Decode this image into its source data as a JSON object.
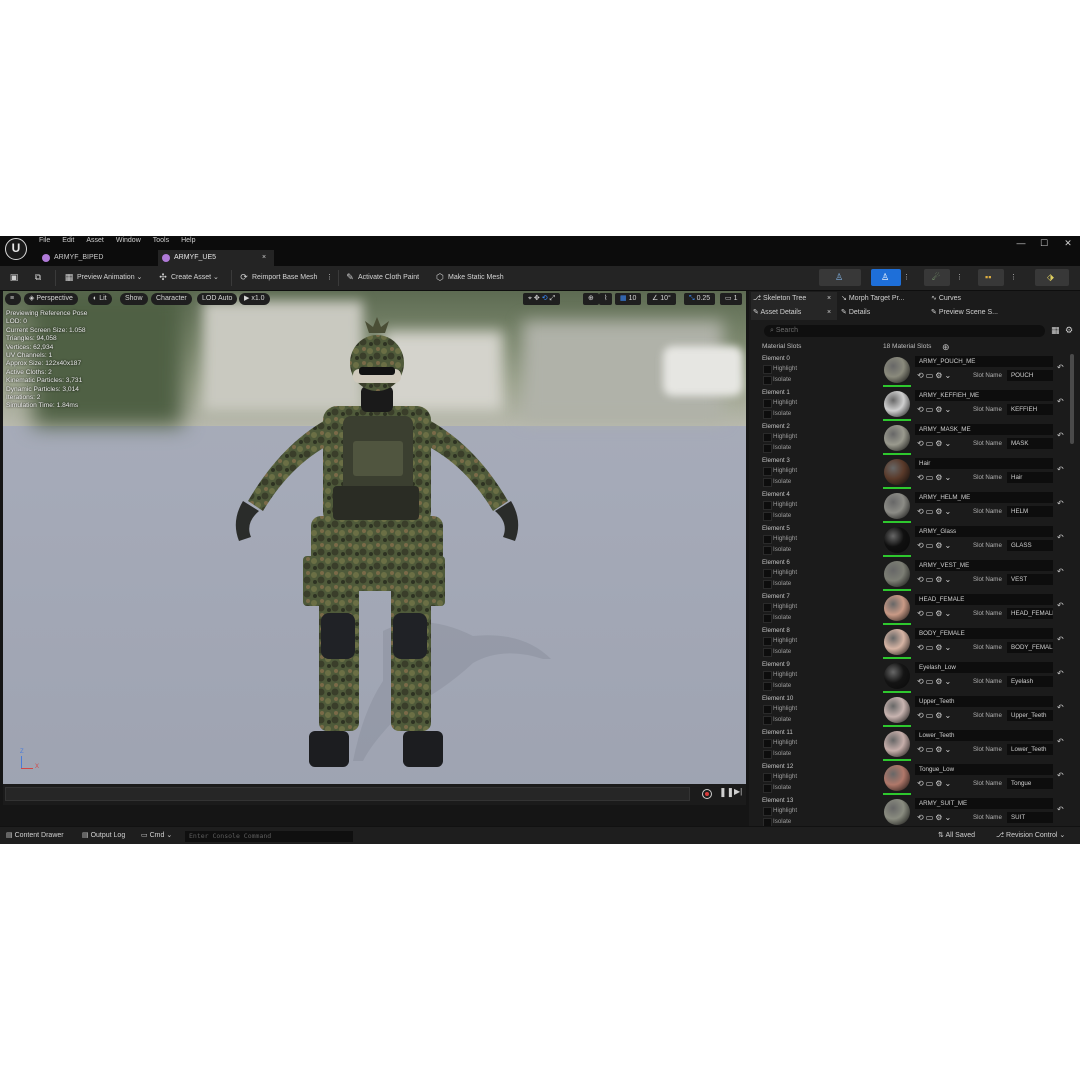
{
  "menu": [
    "File",
    "Edit",
    "Asset",
    "Window",
    "Tools",
    "Help"
  ],
  "tabs": [
    {
      "label": "ARMYF_BIPED"
    },
    {
      "label": "ARMYF_UE5",
      "close": "×"
    }
  ],
  "window_controls": {
    "minimize": "—",
    "maximize": "☐",
    "close": "✕"
  },
  "toolbar": {
    "preview_animation": "Preview Animation",
    "create_asset": "Create Asset",
    "reimport": "Reimport Base Mesh",
    "cloth_paint": "Activate Cloth Paint",
    "static_mesh": "Make Static Mesh"
  },
  "viewport": {
    "perspective": "Perspective",
    "lit": "Lit",
    "show": "Show",
    "character": "Character",
    "lod": "LOD Auto",
    "speed": "x1.0",
    "grid": "10",
    "angle": "10°",
    "scale": "0.25",
    "cam": "1",
    "stats": [
      "Previewing Reference Pose",
      "LOD: 0",
      "Current Screen Size: 1.058",
      "Triangles: 94,058",
      "Vertices: 62,934",
      "UV Channels: 1",
      "Approx Size: 122x40x187",
      "Active Cloths: 2",
      "Kinematic Particles: 3,731",
      "Dynamic Particles: 3,014",
      "Iterations: 2",
      "Simulation Time: 1.84ms"
    ],
    "axis_z": "Z",
    "axis_x": "X"
  },
  "panel": {
    "tabs": [
      "Skeleton Tree",
      "Morph Target Pr...",
      "Curves",
      "Asset Details",
      "Details",
      "Preview Scene S..."
    ],
    "tab_close": "×",
    "search_placeholder": "Search",
    "material_slots_label": "Material Slots",
    "material_slots_count": "18 Material Slots",
    "highlight": "Highlight",
    "isolate": "Isolate",
    "slot_name_label": "Slot Name"
  },
  "elements": [
    {
      "name": "Element 0",
      "material": "ARMY_POUCH_ME",
      "slot": "POUCH",
      "color": "#8a8a7c"
    },
    {
      "name": "Element 1",
      "material": "ARMY_KEFFIEH_ME",
      "slot": "KEFFIEH",
      "color": "#cfcfcf"
    },
    {
      "name": "Element 2",
      "material": "ARMY_MASK_ME",
      "slot": "MASK",
      "color": "#9a9a8e"
    },
    {
      "name": "Element 3",
      "material": "Hair",
      "slot": "Hair",
      "color": "#5a3a2a"
    },
    {
      "name": "Element 4",
      "material": "ARMY_HELM_ME",
      "slot": "HELM",
      "color": "#8c8c86"
    },
    {
      "name": "Element 5",
      "material": "ARMY_Glass",
      "slot": "GLASS",
      "color": "#101010"
    },
    {
      "name": "Element 6",
      "material": "ARMY_VEST_ME",
      "slot": "VEST",
      "color": "#7c7e74"
    },
    {
      "name": "Element 7",
      "material": "HEAD_FEMALE",
      "slot": "HEAD_FEMALE",
      "color": "#c99a86"
    },
    {
      "name": "Element 8",
      "material": "BODY_FEMALE",
      "slot": "BODY_FEMALE",
      "color": "#d6b4a4"
    },
    {
      "name": "Element 9",
      "material": "Eyelash_Low",
      "slot": "Eyelash",
      "color": "#141414"
    },
    {
      "name": "Element 10",
      "material": "Upper_Teeth",
      "slot": "Upper_Teeth",
      "color": "#c8b4b0"
    },
    {
      "name": "Element 11",
      "material": "Lower_Teeth",
      "slot": "Lower_Teeth",
      "color": "#c6aeaa"
    },
    {
      "name": "Element 12",
      "material": "Tongue_Low",
      "slot": "Tongue",
      "color": "#b0786a"
    },
    {
      "name": "Element 13",
      "material": "ARMY_SUIT_ME",
      "slot": "SUIT",
      "color": "#8a8c80"
    }
  ],
  "statusbar": {
    "content_drawer": "Content Drawer",
    "output_log": "Output Log",
    "cmd": "Cmd",
    "console_placeholder": "Enter Console Command",
    "all_saved": "All Saved",
    "revision": "Revision Control"
  },
  "colors": {
    "accent_blue": "#1e6fd9",
    "highlight_green": "#2ec82e",
    "record_red": "#d63a3a",
    "tab_icon": "#b07ad8"
  }
}
